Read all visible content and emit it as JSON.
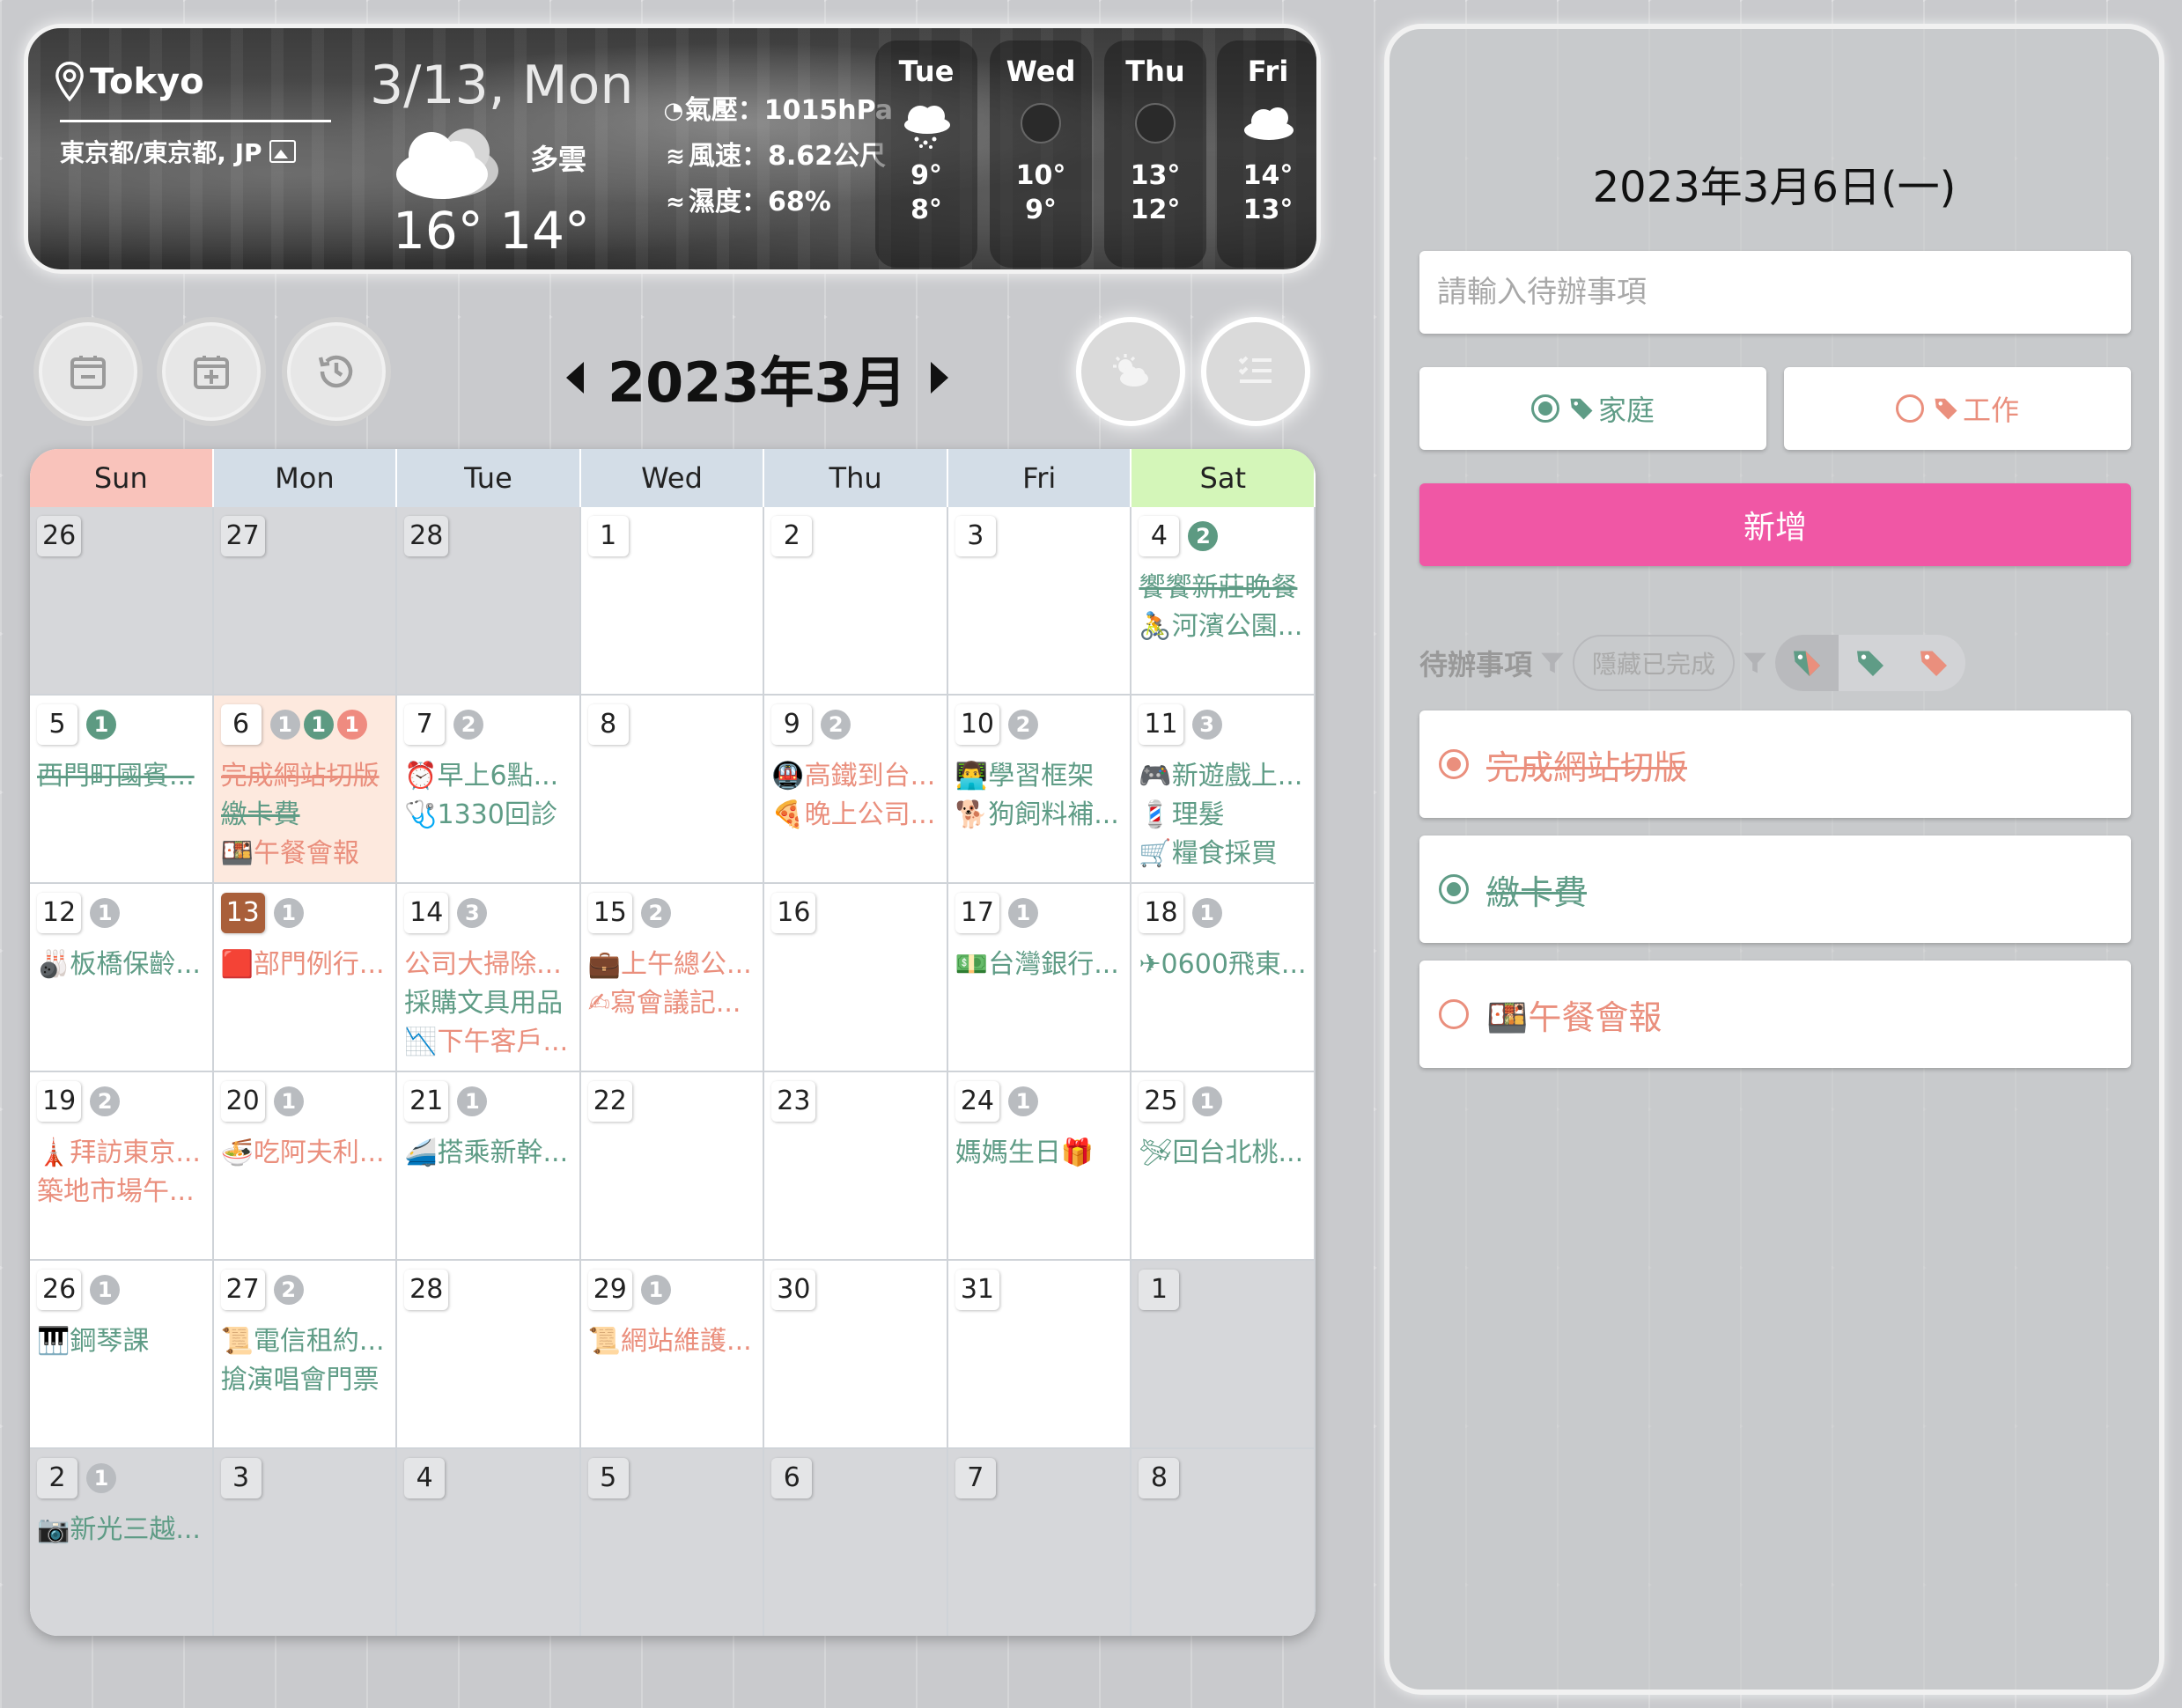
{
  "weather": {
    "city": "Tokyo",
    "region": "東京都/東京都, JP",
    "date": "3/13, Mon",
    "desc": "多雲",
    "temp": "16° 14°",
    "pressure": "氣壓：1015hPa",
    "wind": "風速：8.62公尺",
    "humidity": "濕度：68%",
    "forecast": [
      {
        "day": "Tue",
        "hi": "9°",
        "lo": "8°",
        "icon": "rain-cloud-icon"
      },
      {
        "day": "Wed",
        "hi": "10°",
        "lo": "9°",
        "icon": "overcast-icon"
      },
      {
        "day": "Thu",
        "hi": "13°",
        "lo": "12°",
        "icon": "overcast-icon"
      },
      {
        "day": "Fri",
        "hi": "14°",
        "lo": "13°",
        "icon": "cloud-icon"
      }
    ]
  },
  "toolbar": {
    "icons": [
      "calendar-minus-icon",
      "calendar-plus-icon",
      "history-icon",
      "weather-toggle-icon",
      "todo-list-icon"
    ]
  },
  "calendar": {
    "title": "2023年3月",
    "weekdays": [
      "Sun",
      "Mon",
      "Tue",
      "Wed",
      "Thu",
      "Fri",
      "Sat"
    ],
    "cells": [
      {
        "d": "26",
        "other": true,
        "badges": [],
        "events": []
      },
      {
        "d": "27",
        "other": true,
        "badges": [],
        "events": []
      },
      {
        "d": "28",
        "other": true,
        "badges": [],
        "events": []
      },
      {
        "d": "1",
        "badges": [],
        "events": []
      },
      {
        "d": "2",
        "badges": [],
        "events": []
      },
      {
        "d": "3",
        "badges": [],
        "events": []
      },
      {
        "d": "4",
        "badges": [
          {
            "n": "2",
            "c": "green"
          }
        ],
        "events": [
          {
            "t": "饗饗新莊晚餐",
            "k": "home",
            "done": true
          },
          {
            "t": "🚴河濱公園...",
            "k": "home"
          }
        ]
      },
      {
        "d": "5",
        "badges": [
          {
            "n": "1",
            "c": "green"
          }
        ],
        "events": [
          {
            "t": "西門町國賓...",
            "k": "home",
            "done": true
          }
        ]
      },
      {
        "d": "6",
        "selected": true,
        "badges": [
          {
            "n": "1",
            "c": "gray"
          },
          {
            "n": "1",
            "c": "green"
          },
          {
            "n": "1",
            "c": "red"
          }
        ],
        "events": [
          {
            "t": "完成網站切版",
            "k": "work",
            "done": true
          },
          {
            "t": "繳卡費",
            "k": "home",
            "done": true
          },
          {
            "t": "🍱午餐會報",
            "k": "work"
          }
        ]
      },
      {
        "d": "7",
        "badges": [
          {
            "n": "2",
            "c": "gray"
          }
        ],
        "events": [
          {
            "t": "⏰早上6點...",
            "k": "home"
          },
          {
            "t": "🩺1330回診",
            "k": "home"
          }
        ]
      },
      {
        "d": "8",
        "badges": [],
        "events": []
      },
      {
        "d": "9",
        "badges": [
          {
            "n": "2",
            "c": "gray"
          }
        ],
        "events": [
          {
            "t": "🚇高鐵到台...",
            "k": "work"
          },
          {
            "t": "🍕晚上公司...",
            "k": "work"
          }
        ]
      },
      {
        "d": "10",
        "badges": [
          {
            "n": "2",
            "c": "gray"
          }
        ],
        "events": [
          {
            "t": "👨‍💻學習框架",
            "k": "home"
          },
          {
            "t": "🐕狗飼料補...",
            "k": "home"
          }
        ]
      },
      {
        "d": "11",
        "badges": [
          {
            "n": "3",
            "c": "gray"
          }
        ],
        "events": [
          {
            "t": "🎮新遊戲上...",
            "k": "home"
          },
          {
            "t": "💈理髮",
            "k": "home"
          },
          {
            "t": "🛒糧食採買",
            "k": "home"
          }
        ]
      },
      {
        "d": "12",
        "badges": [
          {
            "n": "1",
            "c": "gray"
          }
        ],
        "events": [
          {
            "t": "🎳板橋保齡...",
            "k": "home"
          }
        ]
      },
      {
        "d": "13",
        "today": true,
        "badges": [
          {
            "n": "1",
            "c": "gray"
          }
        ],
        "events": [
          {
            "t": "🟥部門例行...",
            "k": "work"
          }
        ]
      },
      {
        "d": "14",
        "badges": [
          {
            "n": "3",
            "c": "gray"
          }
        ],
        "events": [
          {
            "t": "公司大掃除...",
            "k": "work"
          },
          {
            "t": "採購文具用品",
            "k": "home"
          },
          {
            "t": "📉下午客戶...",
            "k": "work"
          }
        ]
      },
      {
        "d": "15",
        "badges": [
          {
            "n": "2",
            "c": "gray"
          }
        ],
        "events": [
          {
            "t": "💼上午總公...",
            "k": "work"
          },
          {
            "t": "✍寫會議記...",
            "k": "work"
          }
        ]
      },
      {
        "d": "16",
        "badges": [],
        "events": []
      },
      {
        "d": "17",
        "badges": [
          {
            "n": "1",
            "c": "gray"
          }
        ],
        "events": [
          {
            "t": "💵台灣銀行...",
            "k": "home"
          }
        ]
      },
      {
        "d": "18",
        "badges": [
          {
            "n": "1",
            "c": "gray"
          }
        ],
        "events": [
          {
            "t": "✈0600飛東...",
            "k": "home"
          }
        ]
      },
      {
        "d": "19",
        "badges": [
          {
            "n": "2",
            "c": "gray"
          }
        ],
        "events": [
          {
            "t": "🗼拜訪東京...",
            "k": "work"
          },
          {
            "t": "築地市場午...",
            "k": "work"
          }
        ]
      },
      {
        "d": "20",
        "badges": [
          {
            "n": "1",
            "c": "gray"
          }
        ],
        "events": [
          {
            "t": "🍜吃阿夫利...",
            "k": "work"
          }
        ]
      },
      {
        "d": "21",
        "badges": [
          {
            "n": "1",
            "c": "gray"
          }
        ],
        "events": [
          {
            "t": "🚄搭乘新幹...",
            "k": "home"
          }
        ]
      },
      {
        "d": "22",
        "badges": [],
        "events": []
      },
      {
        "d": "23",
        "badges": [],
        "events": []
      },
      {
        "d": "24",
        "badges": [
          {
            "n": "1",
            "c": "gray"
          }
        ],
        "events": [
          {
            "t": "媽媽生日🎁",
            "k": "home"
          }
        ]
      },
      {
        "d": "25",
        "badges": [
          {
            "n": "1",
            "c": "gray"
          }
        ],
        "events": [
          {
            "t": "🛩回台北桃...",
            "k": "home"
          }
        ]
      },
      {
        "d": "26",
        "badges": [
          {
            "n": "1",
            "c": "gray"
          }
        ],
        "events": [
          {
            "t": "🎹鋼琴課",
            "k": "home"
          }
        ]
      },
      {
        "d": "27",
        "badges": [
          {
            "n": "2",
            "c": "gray"
          }
        ],
        "events": [
          {
            "t": "📜電信租約...",
            "k": "home"
          },
          {
            "t": "搶演唱會門票",
            "k": "home"
          }
        ]
      },
      {
        "d": "28",
        "badges": [],
        "events": []
      },
      {
        "d": "29",
        "badges": [
          {
            "n": "1",
            "c": "gray"
          }
        ],
        "events": [
          {
            "t": "📜網站維護...",
            "k": "work"
          }
        ]
      },
      {
        "d": "30",
        "badges": [],
        "events": []
      },
      {
        "d": "31",
        "badges": [],
        "events": []
      },
      {
        "d": "1",
        "other": true,
        "badges": [],
        "events": []
      },
      {
        "d": "2",
        "other": true,
        "badges": [
          {
            "n": "1",
            "c": "gray"
          }
        ],
        "events": [
          {
            "t": "📷新光三越...",
            "k": "home"
          }
        ]
      },
      {
        "d": "3",
        "other": true,
        "badges": [],
        "events": []
      },
      {
        "d": "4",
        "other": true,
        "badges": [],
        "events": []
      },
      {
        "d": "5",
        "other": true,
        "badges": [],
        "events": []
      },
      {
        "d": "6",
        "other": true,
        "badges": [],
        "events": []
      },
      {
        "d": "7",
        "other": true,
        "badges": [],
        "events": []
      },
      {
        "d": "8",
        "other": true,
        "badges": [],
        "events": []
      }
    ]
  },
  "panel": {
    "date": "2023年3月6日(一)",
    "input_placeholder": "請輸入待辦事項",
    "tag_home": "家庭",
    "tag_work": "工作",
    "add_label": "新增",
    "list_label": "待辦事項",
    "hide_done_label": "隱藏已完成",
    "todos": [
      {
        "text": "完成網站切版",
        "kind": "work",
        "done": true
      },
      {
        "text": "繳卡費",
        "kind": "home",
        "done": true
      },
      {
        "text": "🍱午餐會報",
        "kind": "work",
        "done": false
      }
    ]
  },
  "colors": {
    "home": "#5f9c86",
    "work": "#ea8f7d",
    "add_button": "#f057a5",
    "today": "#a95f3a"
  }
}
